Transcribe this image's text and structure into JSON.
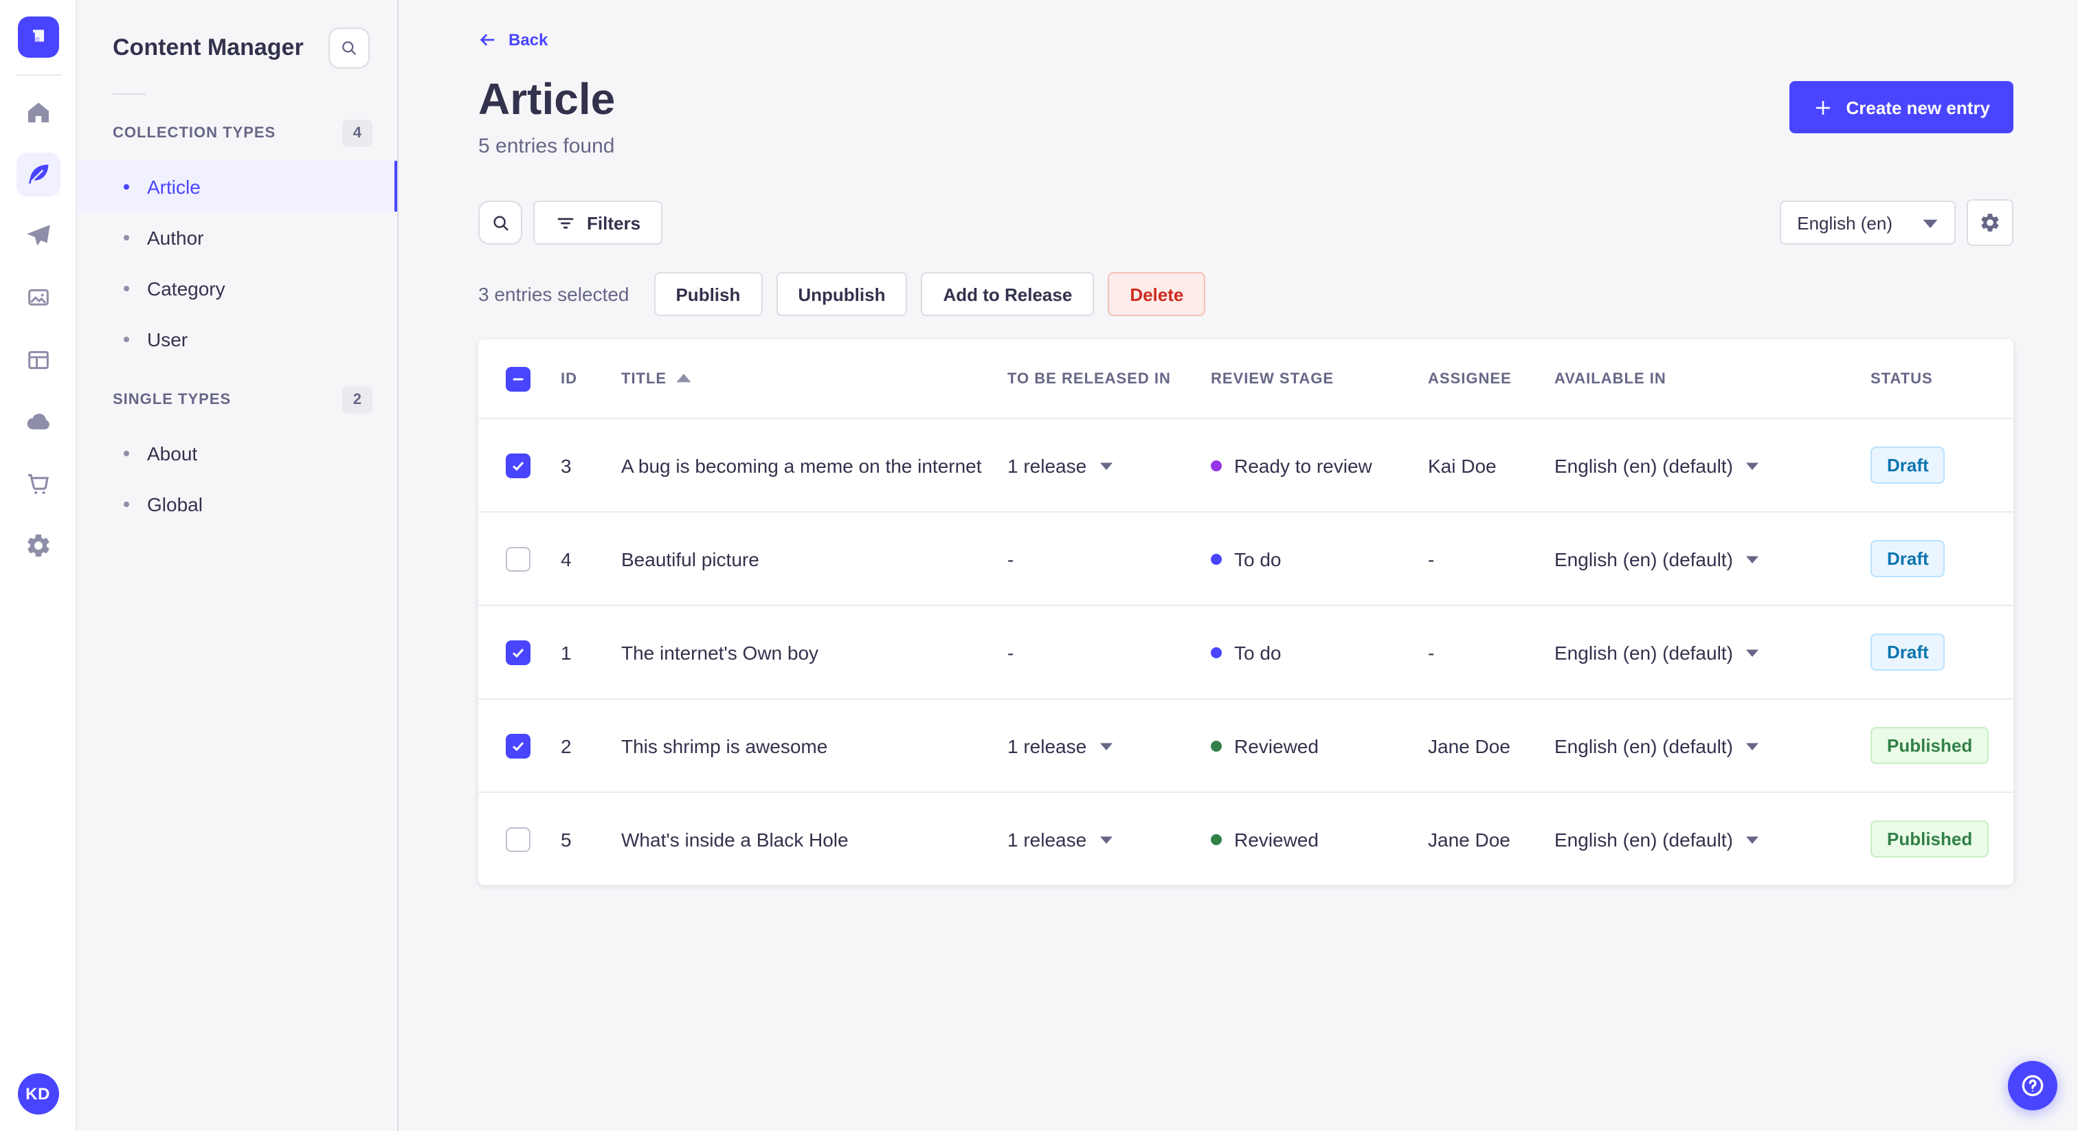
{
  "colors": {
    "accent": "#4945ff",
    "accent_light_bg": "#f0f0ff",
    "text": "#32324d",
    "text_muted": "#666687",
    "page_bg": "#f6f6f9",
    "border": "#dcdce4",
    "divider": "#eaeaef",
    "danger_text": "#d02b20",
    "danger_bg": "#fcecea",
    "danger_border": "#f5c0b8",
    "draft_bg": "#eaf5ff",
    "draft_border": "#b8e1ff",
    "draft_text": "#0c75af",
    "published_bg": "#eafbe7",
    "published_border": "#c6f0c2",
    "published_text": "#328048",
    "stage_ready_to_review": "#9736e8",
    "stage_to_do": "#4945ff",
    "stage_reviewed": "#328048"
  },
  "rail": {
    "logo_icon": "strapi-logo",
    "icons": [
      {
        "name": "home-icon",
        "active": false
      },
      {
        "name": "feather-icon",
        "active": true
      },
      {
        "name": "paper-plane-icon",
        "active": false
      },
      {
        "name": "media-images-icon",
        "active": false
      },
      {
        "name": "layout-icon",
        "active": false
      },
      {
        "name": "cloud-icon",
        "active": false
      },
      {
        "name": "cart-icon",
        "active": false
      },
      {
        "name": "gear-icon",
        "active": false
      }
    ],
    "avatar_initials": "KD"
  },
  "subnav": {
    "title": "Content Manager",
    "sections": [
      {
        "label": "COLLECTION TYPES",
        "badge": "4",
        "items": [
          {
            "label": "Article",
            "active": true
          },
          {
            "label": "Author",
            "active": false
          },
          {
            "label": "Category",
            "active": false
          },
          {
            "label": "User",
            "active": false
          }
        ]
      },
      {
        "label": "SINGLE TYPES",
        "badge": "2",
        "items": [
          {
            "label": "About",
            "active": false
          },
          {
            "label": "Global",
            "active": false
          }
        ]
      }
    ]
  },
  "header": {
    "back_label": "Back",
    "title": "Article",
    "subtitle": "5 entries found",
    "create_button_label": "Create new entry"
  },
  "toolbar": {
    "filters_label": "Filters",
    "locale_selected": "English (en)"
  },
  "selection": {
    "summary": "3 entries selected",
    "publish_label": "Publish",
    "unpublish_label": "Unpublish",
    "add_to_release_label": "Add to Release",
    "delete_label": "Delete"
  },
  "table": {
    "header_checkbox_state": "indeterminate",
    "sort": {
      "column": "TITLE",
      "direction": "asc"
    },
    "columns": {
      "id": "ID",
      "title": "TITLE",
      "release": "TO BE RELEASED IN",
      "stage": "REVIEW STAGE",
      "assignee": "ASSIGNEE",
      "available": "AVAILABLE IN",
      "status": "STATUS"
    },
    "rows": [
      {
        "checked": true,
        "id": "3",
        "title": "A bug is becoming a meme on the internet",
        "release": "1 release",
        "has_release_menu": true,
        "stage": "Ready to review",
        "stage_color": "#9736e8",
        "assignee": "Kai Doe",
        "available": "English (en) (default)",
        "status": "Draft",
        "status_type": "draft"
      },
      {
        "checked": false,
        "id": "4",
        "title": "Beautiful picture",
        "release": "-",
        "has_release_menu": false,
        "stage": "To do",
        "stage_color": "#4945ff",
        "assignee": "-",
        "available": "English (en) (default)",
        "status": "Draft",
        "status_type": "draft"
      },
      {
        "checked": true,
        "id": "1",
        "title": "The internet's Own boy",
        "release": "-",
        "has_release_menu": false,
        "stage": "To do",
        "stage_color": "#4945ff",
        "assignee": "-",
        "available": "English (en) (default)",
        "status": "Draft",
        "status_type": "draft"
      },
      {
        "checked": true,
        "id": "2",
        "title": "This shrimp is awesome",
        "release": "1 release",
        "has_release_menu": true,
        "stage": "Reviewed",
        "stage_color": "#328048",
        "assignee": "Jane Doe",
        "available": "English (en) (default)",
        "status": "Published",
        "status_type": "published"
      },
      {
        "checked": false,
        "id": "5",
        "title": "What's inside a Black Hole",
        "release": "1 release",
        "has_release_menu": true,
        "stage": "Reviewed",
        "stage_color": "#328048",
        "assignee": "Jane Doe",
        "available": "English (en) (default)",
        "status": "Published",
        "status_type": "published"
      }
    ]
  },
  "fab": {
    "icon": "question-mark-icon"
  }
}
